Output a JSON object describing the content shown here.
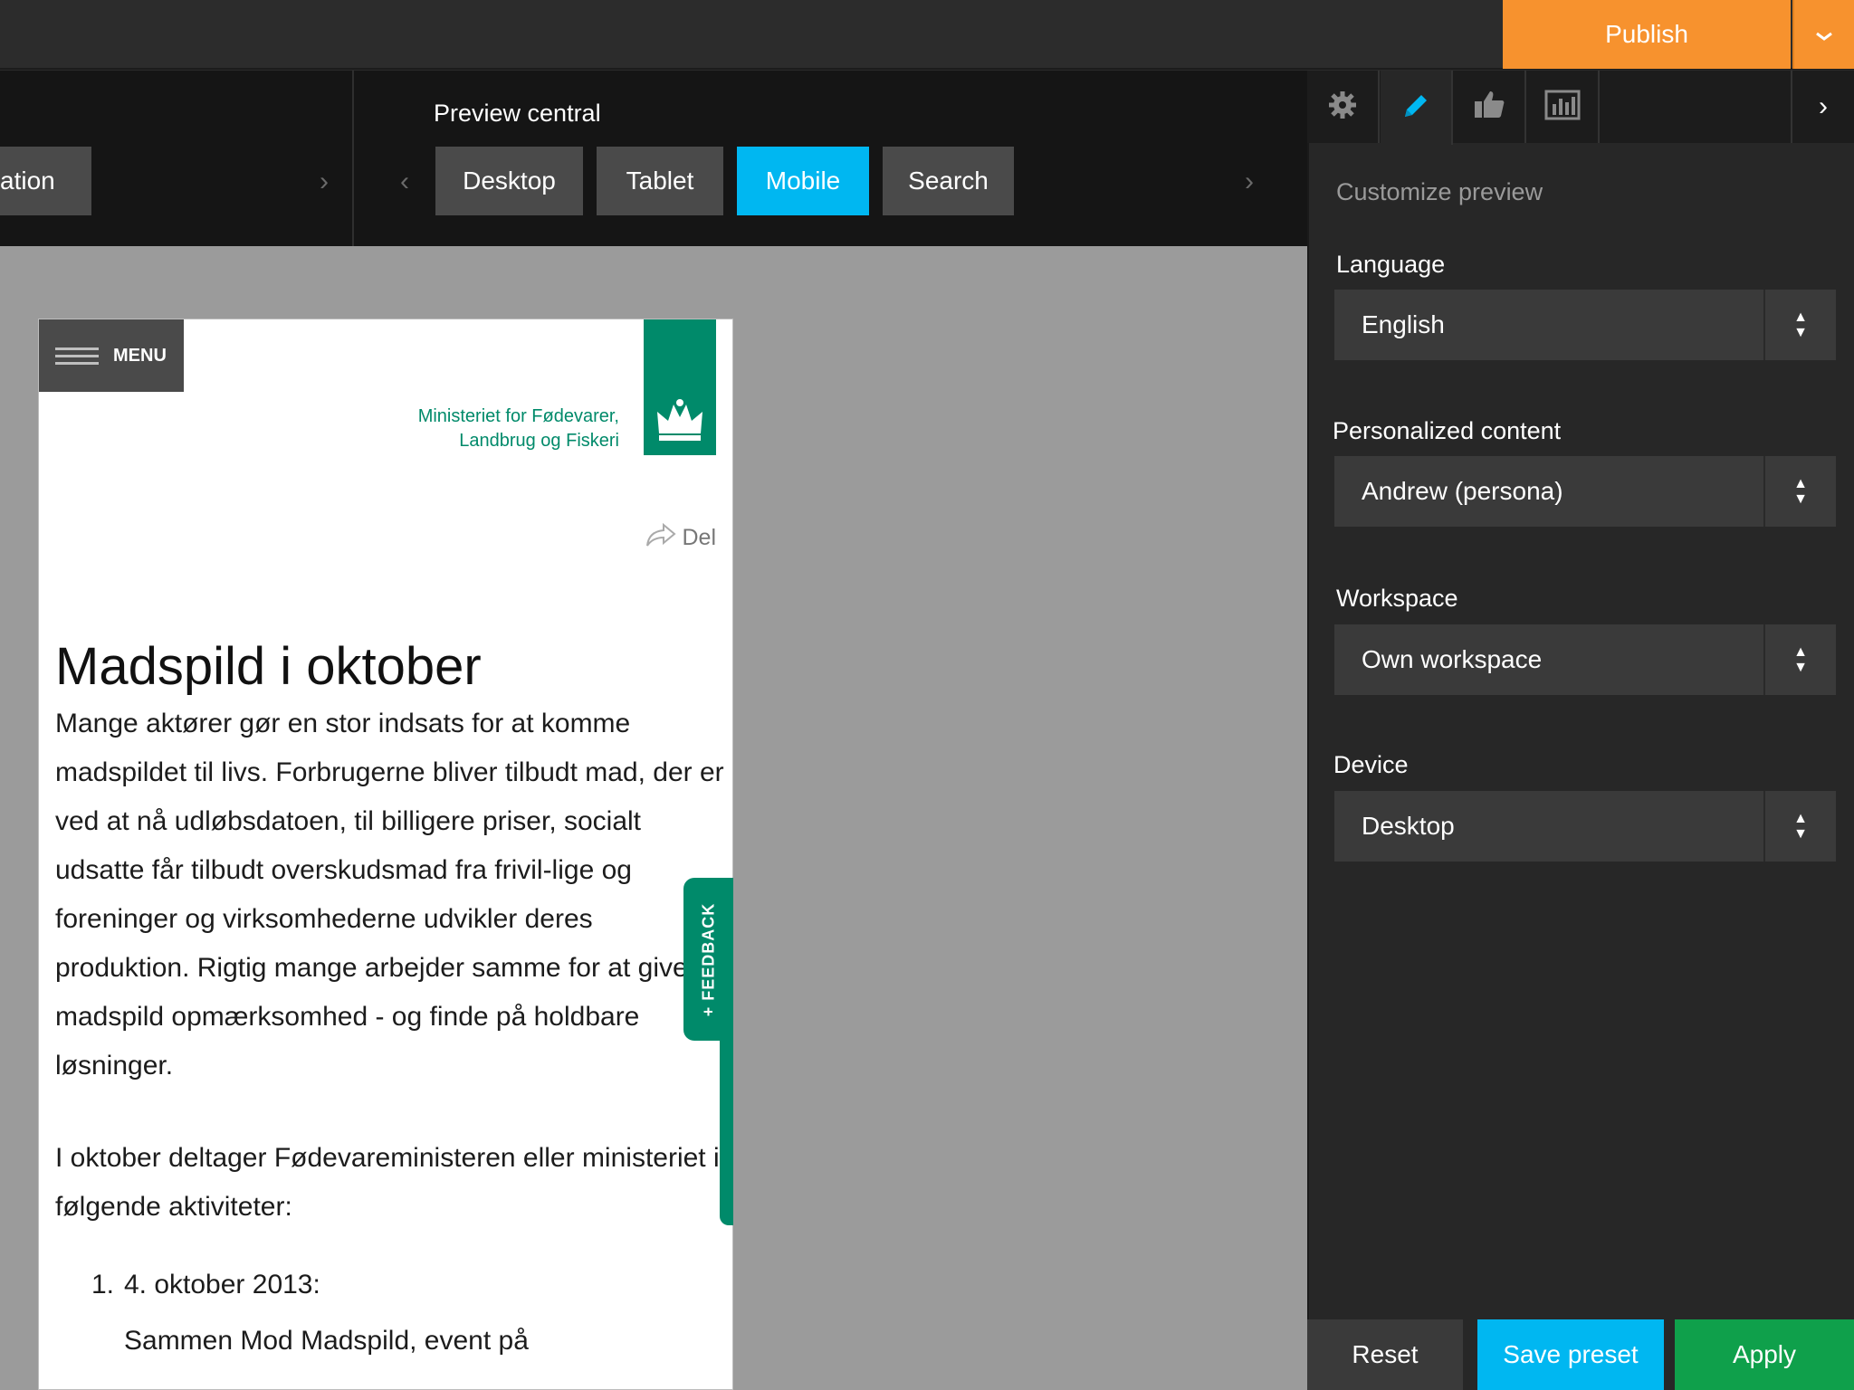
{
  "topbar": {
    "publish_label": "Publish",
    "publish_dropdown_icon": "chevron-down-icon"
  },
  "channels_left": {
    "partial_label": "ation"
  },
  "preview": {
    "title": "Preview central",
    "channels": [
      "Desktop",
      "Tablet",
      "Mobile",
      "Search"
    ],
    "active_channel": "Mobile"
  },
  "device_page": {
    "menu_label": "MENU",
    "ministry_line1": "Ministeriet for Fødevarer,",
    "ministry_line2": "Landbrug og Fiskeri",
    "share_label": "Del",
    "title": "Madspild i oktober",
    "para1": "Mange aktører gør en stor indsats for at komme madspildet til livs. Forbrugerne bliver tilbudt mad, der er ved at nå udløbsdatoen, til billigere priser, socialt udsatte får tilbudt overskudsmad fra frivil-lige og foreninger og virksomhederne udvikler deres produktion. Rigtig mange arbejder samme for at give madspild opmærksomhed - og finde på holdbare løsninger.",
    "para2": "I oktober deltager Fødevareministeren eller ministeriet i følgende aktiviteter:",
    "list_num": "1.",
    "list_item": "4. oktober 2013:",
    "list_sub": "Sammen Mod Madspild, event på",
    "feedback_label": "+ FEEDBACK"
  },
  "panel": {
    "tabs": [
      "gear-icon",
      "pencil-icon",
      "thumbs-up-icon",
      "chart-icon"
    ],
    "active_tab": "pencil-icon",
    "heading": "Customize preview",
    "language_label": "Language",
    "language_value": "English",
    "personalized_label": "Personalized content",
    "personalized_value": "Andrew (persona)",
    "workspace_label": "Workspace",
    "workspace_value": "Own workspace",
    "device_label": "Device",
    "device_value": "Desktop",
    "reset_label": "Reset",
    "save_label": "Save preset",
    "apply_label": "Apply"
  },
  "colors": {
    "accent_orange": "#f7922e",
    "accent_blue": "#00b7f1",
    "accent_green": "#0fa04b",
    "brand_green": "#008a6a"
  }
}
